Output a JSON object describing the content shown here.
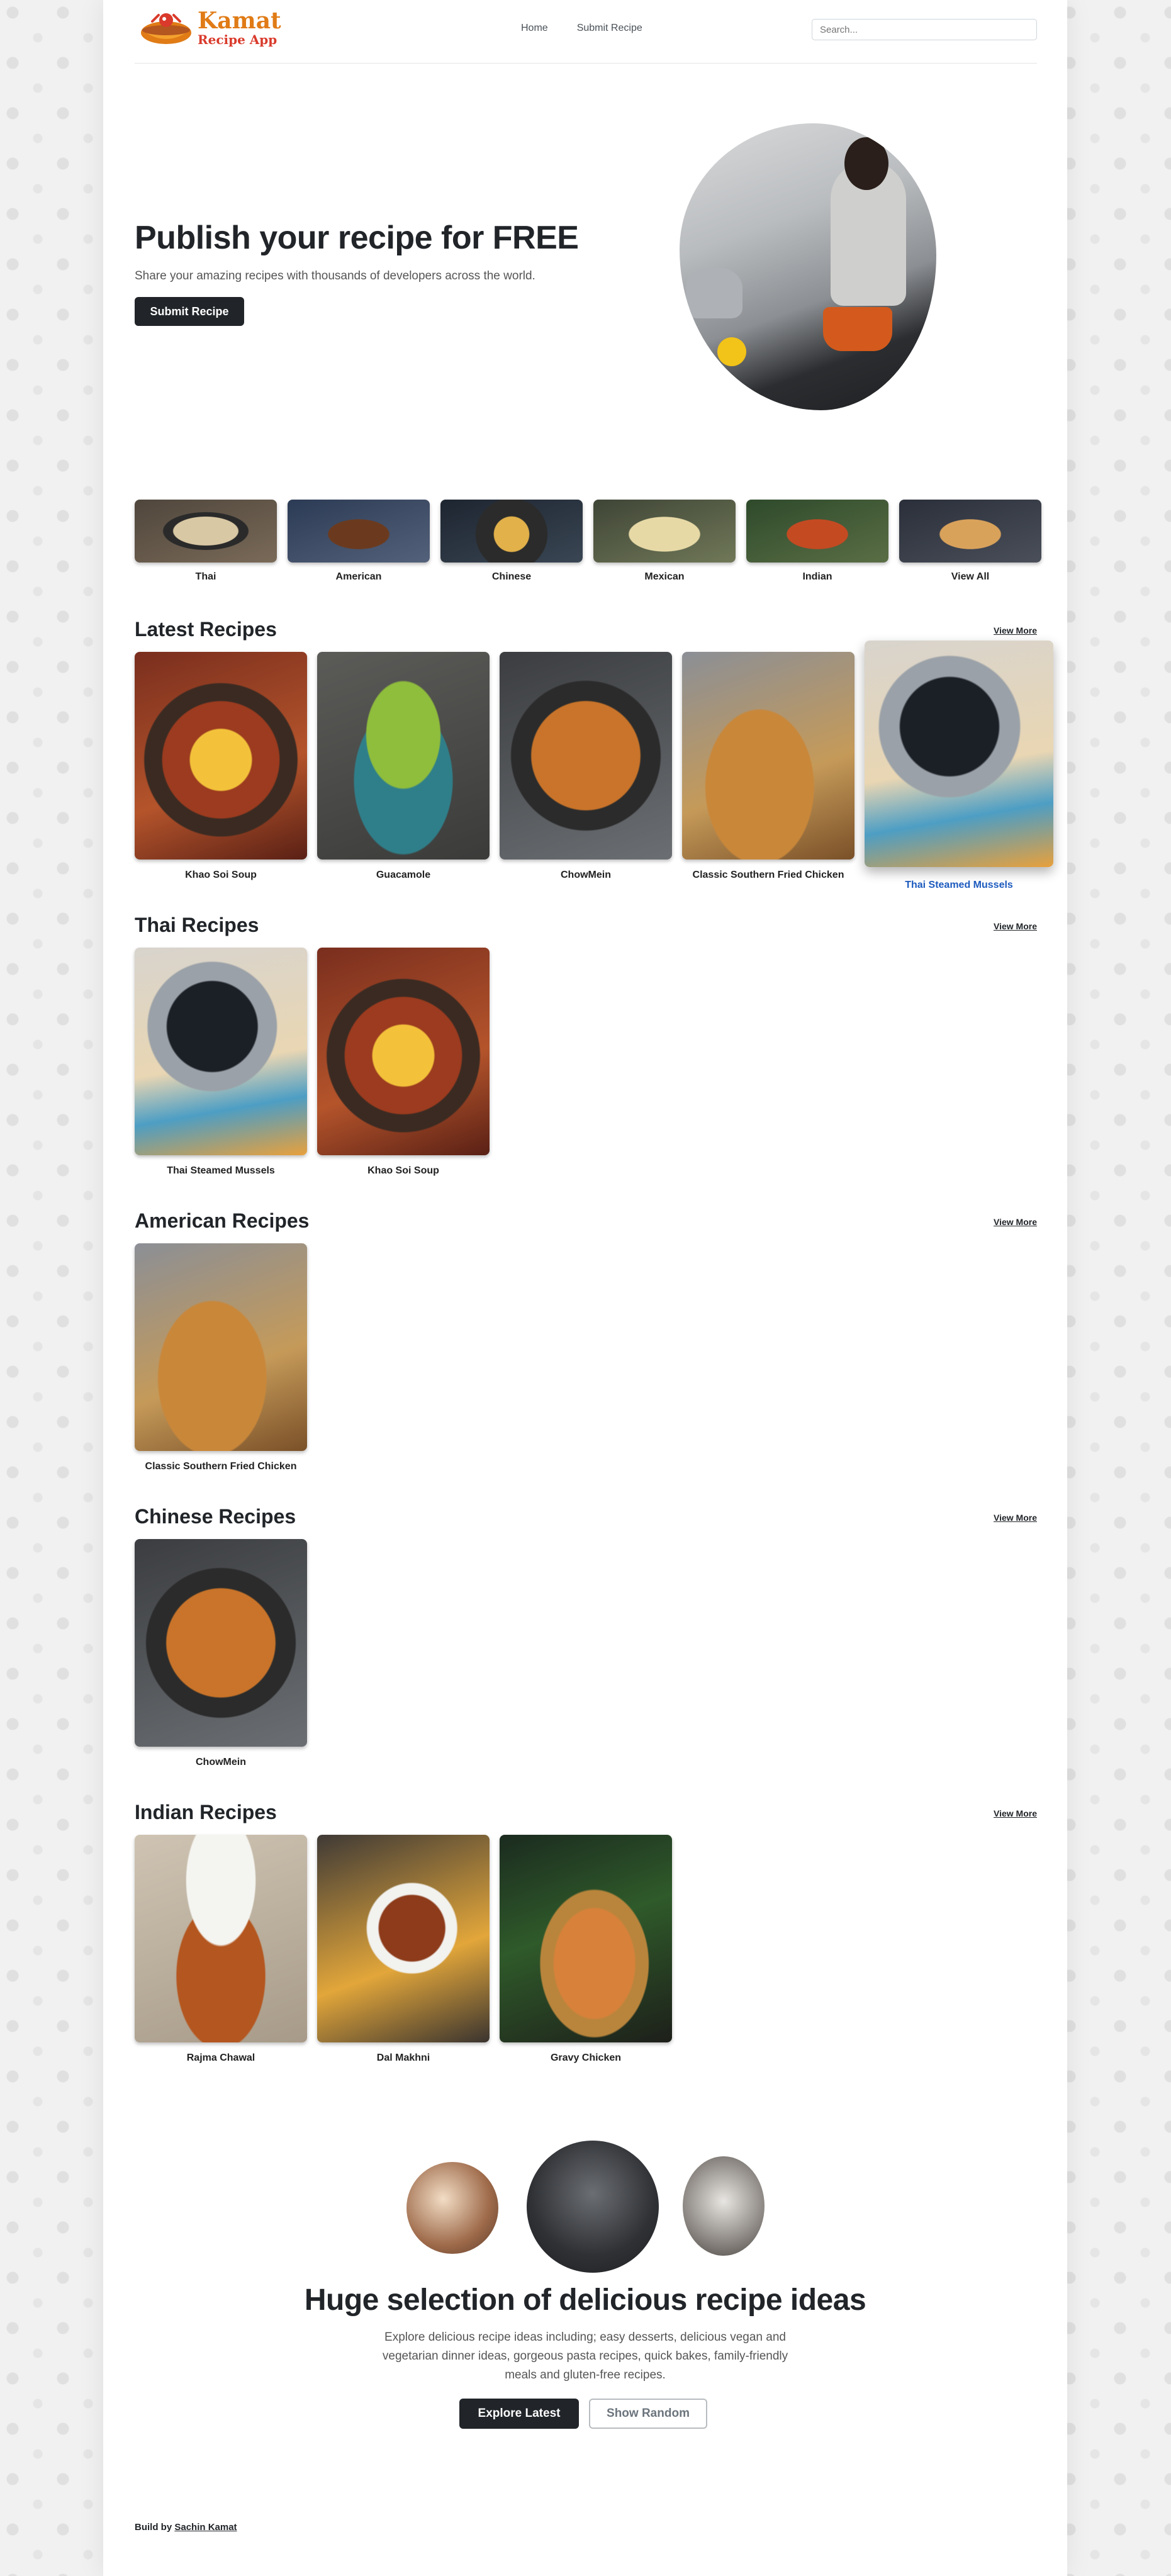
{
  "header": {
    "logo_title": "Kamat",
    "logo_subtitle": "Recipe App",
    "nav": [
      "Home",
      "Submit Recipe"
    ],
    "search_placeholder": "Search..."
  },
  "hero": {
    "title": "Publish your recipe for FREE",
    "subtitle": "Share your amazing recipes with thousands of developers across the world.",
    "button": "Submit Recipe"
  },
  "categories": [
    "Thai",
    "American",
    "Chinese",
    "Mexican",
    "Indian",
    "View All"
  ],
  "sections": [
    {
      "title": "Latest Recipes",
      "view_more": "View More",
      "items": [
        "Khao Soi Soup",
        "Guacamole",
        "ChowMein",
        "Classic Southern Fried Chicken",
        "Thai Steamed Mussels"
      ],
      "hovered": "Thai Steamed Mussels"
    },
    {
      "title": "Thai Recipes",
      "view_more": "View More",
      "items": [
        "Thai Steamed Mussels",
        "Khao Soi Soup"
      ]
    },
    {
      "title": "American Recipes",
      "view_more": "View More",
      "items": [
        "Classic Southern Fried Chicken"
      ]
    },
    {
      "title": "Chinese Recipes",
      "view_more": "View More",
      "items": [
        "ChowMein"
      ]
    },
    {
      "title": "Indian Recipes",
      "view_more": "View More",
      "items": [
        "Rajma Chawal",
        "Dal Makhni",
        "Gravy Chicken"
      ]
    }
  ],
  "promo": {
    "title": "Huge selection of delicious recipe ideas",
    "text": "Explore delicious recipe ideas including; easy desserts, delicious vegan and vegetarian dinner ideas, gorgeous pasta recipes, quick bakes, family-friendly meals and gluten-free recipes.",
    "explore_button": "Explore Latest",
    "random_button": "Show Random"
  },
  "footer": {
    "prefix": "Build by",
    "author": "Sachin Kamat"
  },
  "colors": {
    "logo_primary": "#e07b16",
    "logo_secondary": "#d93a2b",
    "dark_button": "#212529",
    "hover_link": "#1d5bbf"
  }
}
